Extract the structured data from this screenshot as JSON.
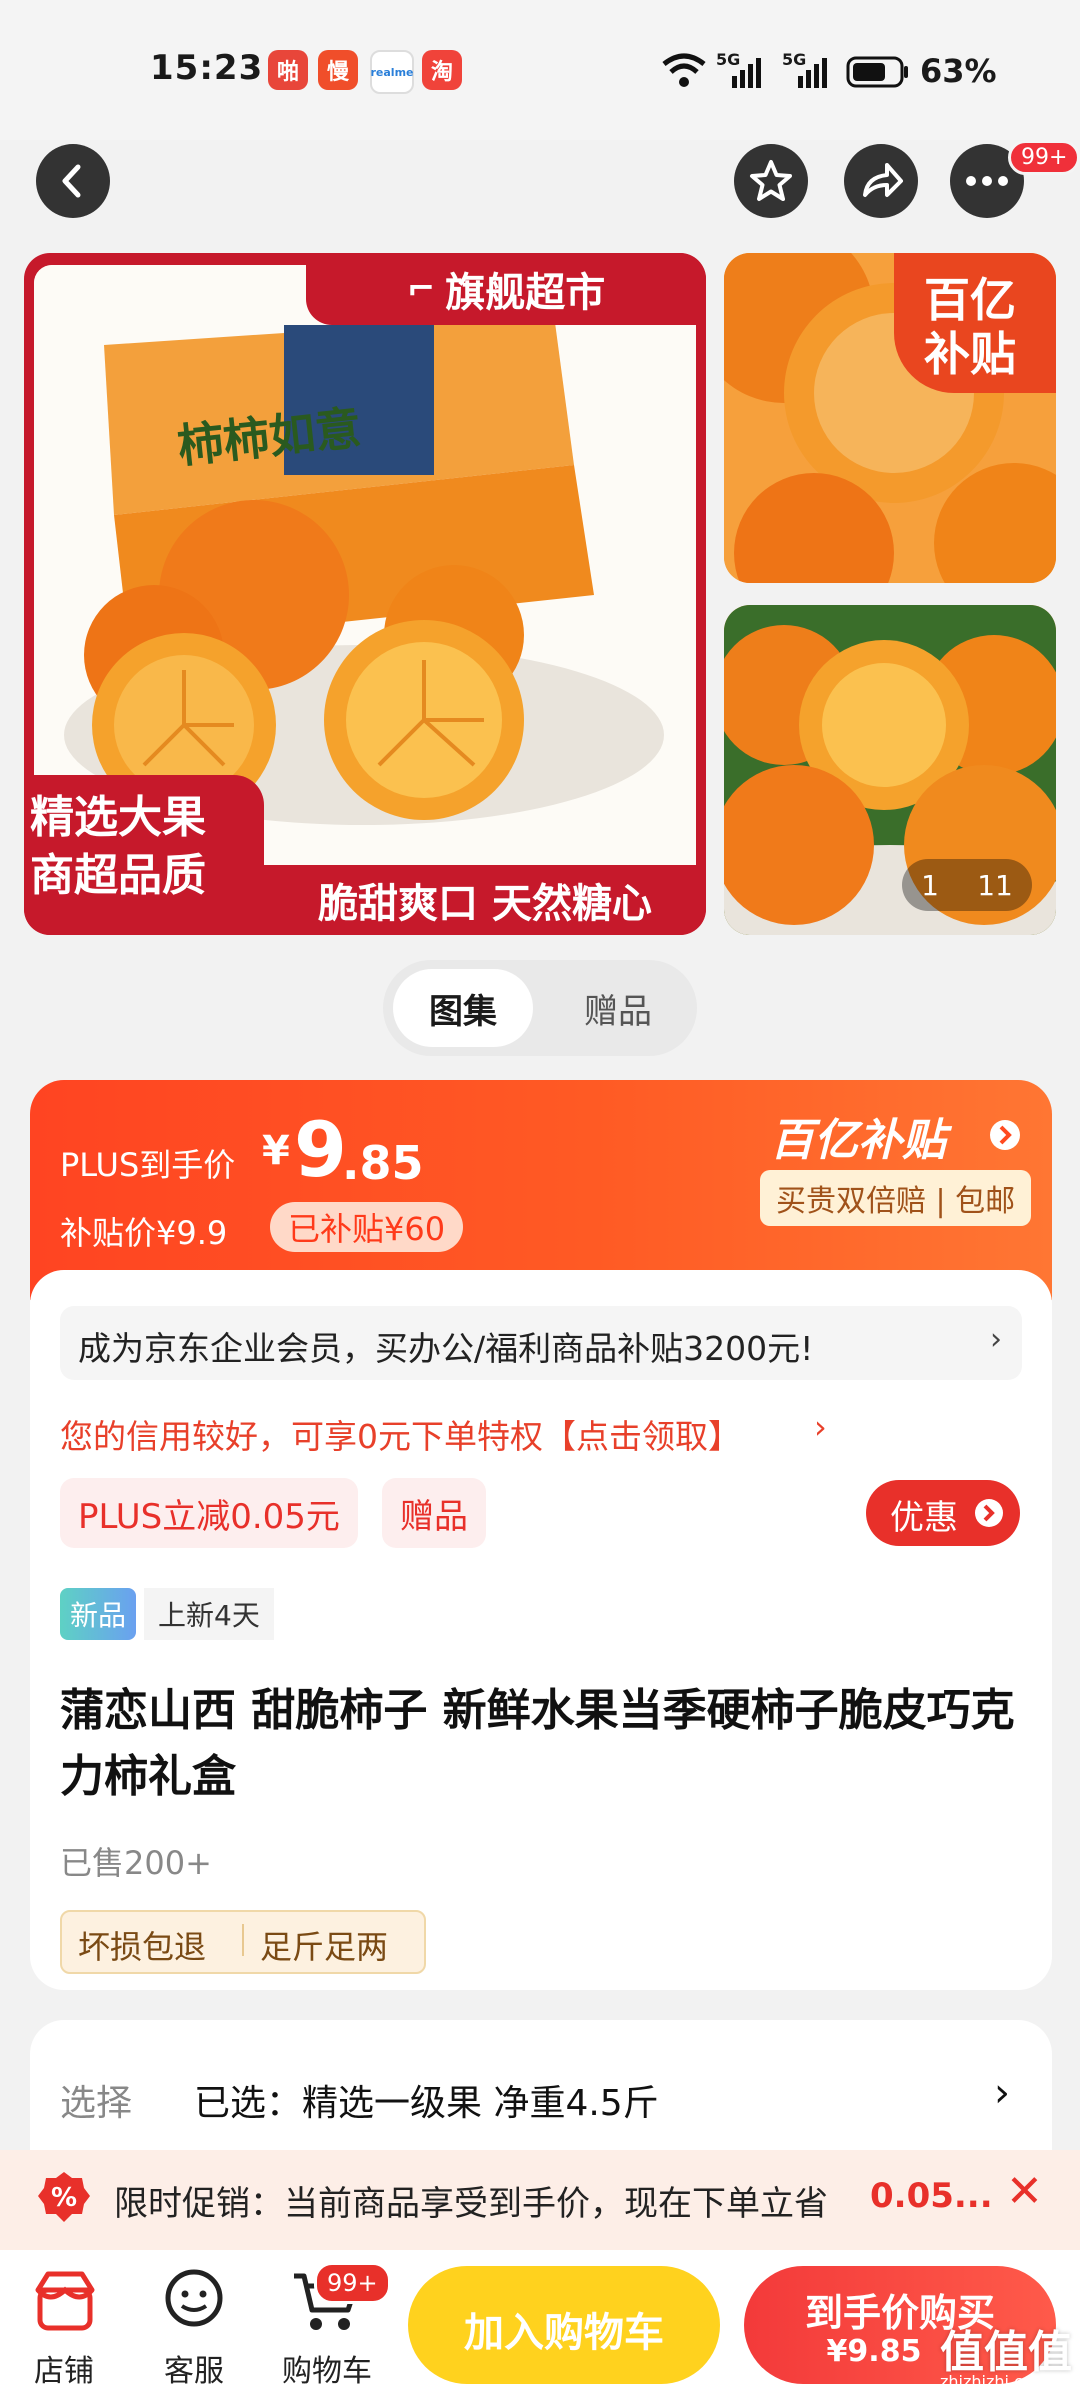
{
  "status": {
    "time": "15:23",
    "apps": [
      {
        "name": "app-icon-1",
        "glyph": "啪",
        "color": "#e8463a"
      },
      {
        "name": "app-icon-2",
        "glyph": "慢",
        "color": "#f04e2a"
      },
      {
        "name": "app-icon-3",
        "glyph": "realme",
        "color": "#ffffff"
      },
      {
        "name": "app-icon-4",
        "glyph": "淘",
        "color": "#f0433a"
      }
    ],
    "network1": "5G",
    "network2": "5G",
    "battery": "63%"
  },
  "nav": {
    "badge": "99+"
  },
  "gallery": {
    "main_top_right": "旗舰超市",
    "main_bottom_left_1": "精选大果",
    "main_bottom_left_2": "商超品质",
    "main_bottom_right": "脆甜爽口 天然糖心",
    "box_text": "柿柿如意",
    "subsidy_badge_1": "百亿",
    "subsidy_badge_2": "补贴",
    "page_current": "1",
    "page_total": "11",
    "tabs": [
      "图集",
      "赠品"
    ]
  },
  "price": {
    "plus_label": "PLUS到手价",
    "currency": "¥",
    "int_part": "9",
    "dec_part": ".85",
    "subsidy_price_label": "补贴价¥9.9",
    "subsidized": "已补贴¥60",
    "program_name": "百亿补贴",
    "program_tags": "买贵双倍赔 | 包邮"
  },
  "info": {
    "enterprise_banner": "成为京东企业会员，买办公/福利商品补贴3200元!",
    "credit_line": "您的信用较好，可享0元下单特权【点击领取】",
    "tag_plus": "PLUS立减0.05元",
    "tag_gift": "赠品",
    "discount_btn": "优惠",
    "new_badge": "新品",
    "new_days": "上新4天",
    "title": "蒲恋山西 甜脆柿子 新鲜水果当季硬柿子脆皮巧克力柿礼盒",
    "sold": "已售200+",
    "service_1": "坏损包退",
    "service_2": "足斤足两"
  },
  "select": {
    "label": "选择",
    "value": "已选：精选一级果 净重4.5斤"
  },
  "promo": {
    "text": "限时促销：当前商品享受到手价，现在下单立省",
    "amount": "0.05..."
  },
  "bottom": {
    "shop": "店铺",
    "service": "客服",
    "cart": "购物车",
    "cart_badge": "99+",
    "add_cart": "加入购物车",
    "buy": "到手价购买",
    "buy_price": "¥9.85",
    "watermark": "值值值",
    "watermark_url": "zhizhizhi.com"
  },
  "colors": {
    "jd_red": "#f0303a",
    "orange": "#ff5a24",
    "yellow_btn": "#ffd21e"
  }
}
